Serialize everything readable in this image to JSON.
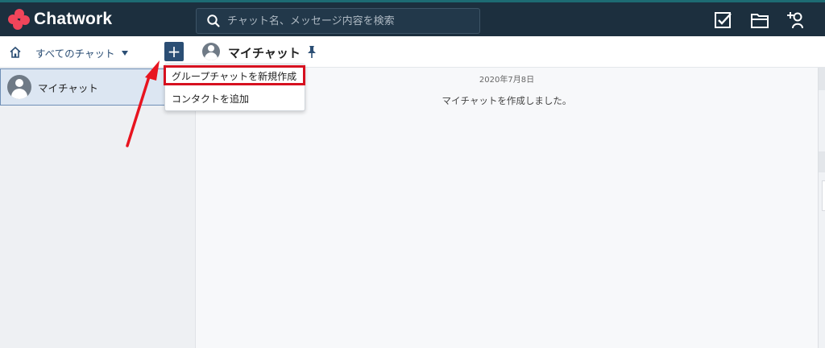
{
  "app": {
    "name": "Chatwork",
    "brand_color": "#f0455a",
    "header_bg": "#1c2f3e"
  },
  "search": {
    "placeholder": "チャット名、メッセージ内容を検索"
  },
  "header_icons": [
    "task-check-icon",
    "file-folder-icon",
    "contact-add-icon"
  ],
  "nav": {
    "filter_label": "すべてのチャット",
    "add_button_label": "+"
  },
  "sidebar": {
    "rooms": [
      {
        "name": "マイチャット"
      }
    ]
  },
  "chat": {
    "title": "マイチャット",
    "date_label": "2020年7月8日",
    "system_message": "マイチャットを作成しました。"
  },
  "menu": {
    "items": [
      {
        "label": "グループチャットを新規作成"
      },
      {
        "label": "コンタクトを追加"
      }
    ]
  },
  "annotation": {
    "highlight_color": "#d6101f",
    "arrow_color": "#e8141f"
  }
}
